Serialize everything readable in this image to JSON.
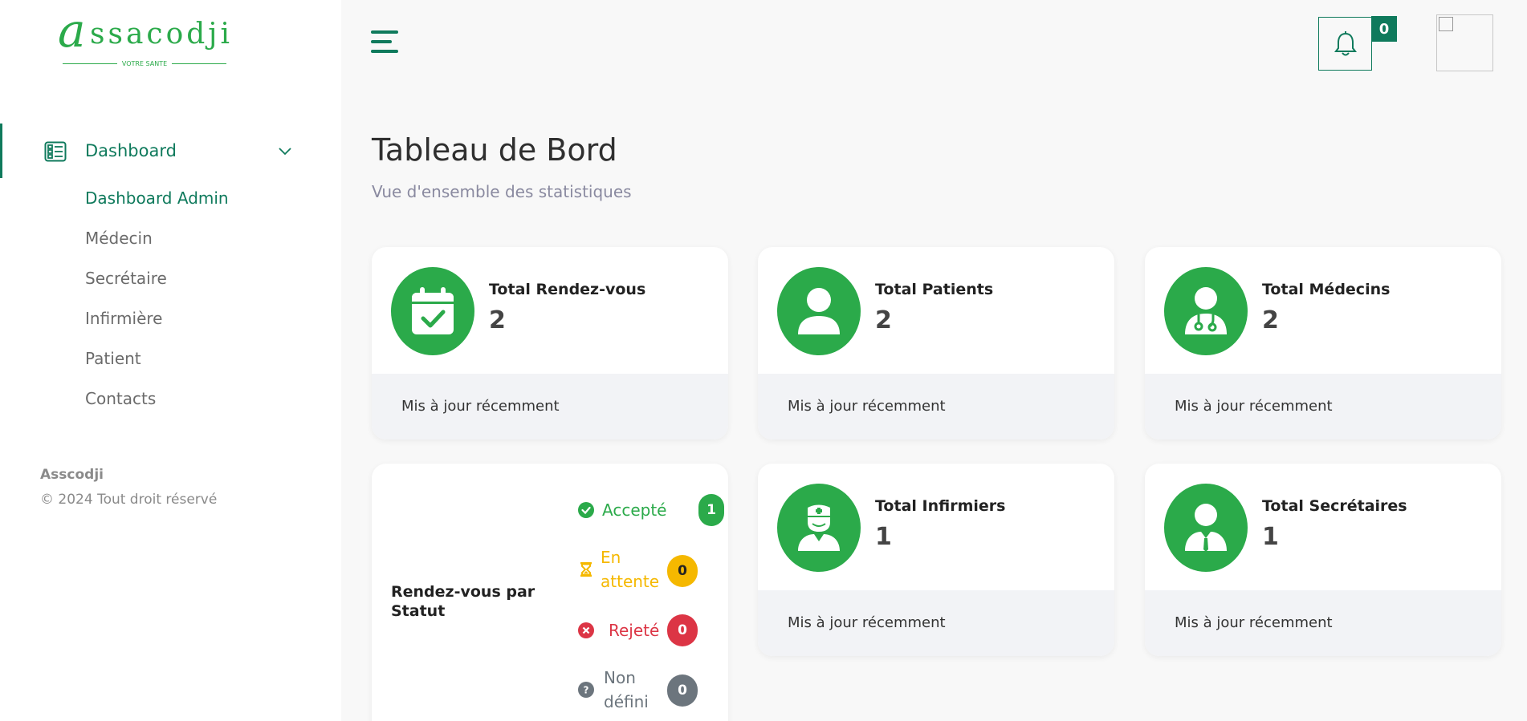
{
  "brand": {
    "logo_letter": "a",
    "logo_word": "ssacodji",
    "tagline": "VOTRE SANTE",
    "footer_name": "Asscodji",
    "footer_copyright": "© 2024 Tout droit réservé"
  },
  "sidebar": {
    "main_item": {
      "label": "Dashboard",
      "icon": "dashboard-icon"
    },
    "sub_items": [
      {
        "label": "Dashboard Admin",
        "active": true
      },
      {
        "label": "Médecin",
        "active": false
      },
      {
        "label": "Secrétaire",
        "active": false
      },
      {
        "label": "Infirmière",
        "active": false
      },
      {
        "label": "Patient",
        "active": false
      },
      {
        "label": "Contacts",
        "active": false
      }
    ]
  },
  "header": {
    "notification_count": "0",
    "accent_color": "#0f7a5c"
  },
  "page": {
    "title": "Tableau de Bord",
    "subtitle": "Vue d'ensemble des statistiques"
  },
  "stats": [
    {
      "title": "Total Rendez-vous",
      "value": "2",
      "footer": "Mis à jour récemment",
      "icon": "calendar-check-icon"
    },
    {
      "title": "Total Patients",
      "value": "2",
      "footer": "Mis à jour récemment",
      "icon": "user-icon"
    },
    {
      "title": "Total Médecins",
      "value": "2",
      "footer": "Mis à jour récemment",
      "icon": "doctor-icon"
    },
    {
      "title": "Total Infirmiers",
      "value": "1",
      "footer": "Mis à jour récemment",
      "icon": "nurse-icon"
    },
    {
      "title": "Total Secrétaires",
      "value": "1",
      "footer": "Mis à jour récemment",
      "icon": "secretary-icon"
    }
  ],
  "status_card": {
    "title": "Rendez-vous par Statut",
    "rows": [
      {
        "label": "Accepté",
        "count": "1",
        "color": "#2baa4a",
        "icon": "check-circle-icon"
      },
      {
        "label_line1": "En",
        "label_line2": "attente",
        "count": "0",
        "color": "#f5b800",
        "icon": "hourglass-icon"
      },
      {
        "label": "Rejeté",
        "count": "0",
        "color": "#dc3545",
        "icon": "x-circle-icon"
      },
      {
        "label_line1": "Non",
        "label_line2": "défini",
        "count": "0",
        "color": "#6c757d",
        "icon": "question-circle-icon"
      }
    ]
  },
  "colors": {
    "primary_green": "#2baa4a",
    "dark_teal": "#0f7a5c",
    "warning": "#f5b800",
    "danger": "#dc3545",
    "muted": "#6c757d"
  }
}
